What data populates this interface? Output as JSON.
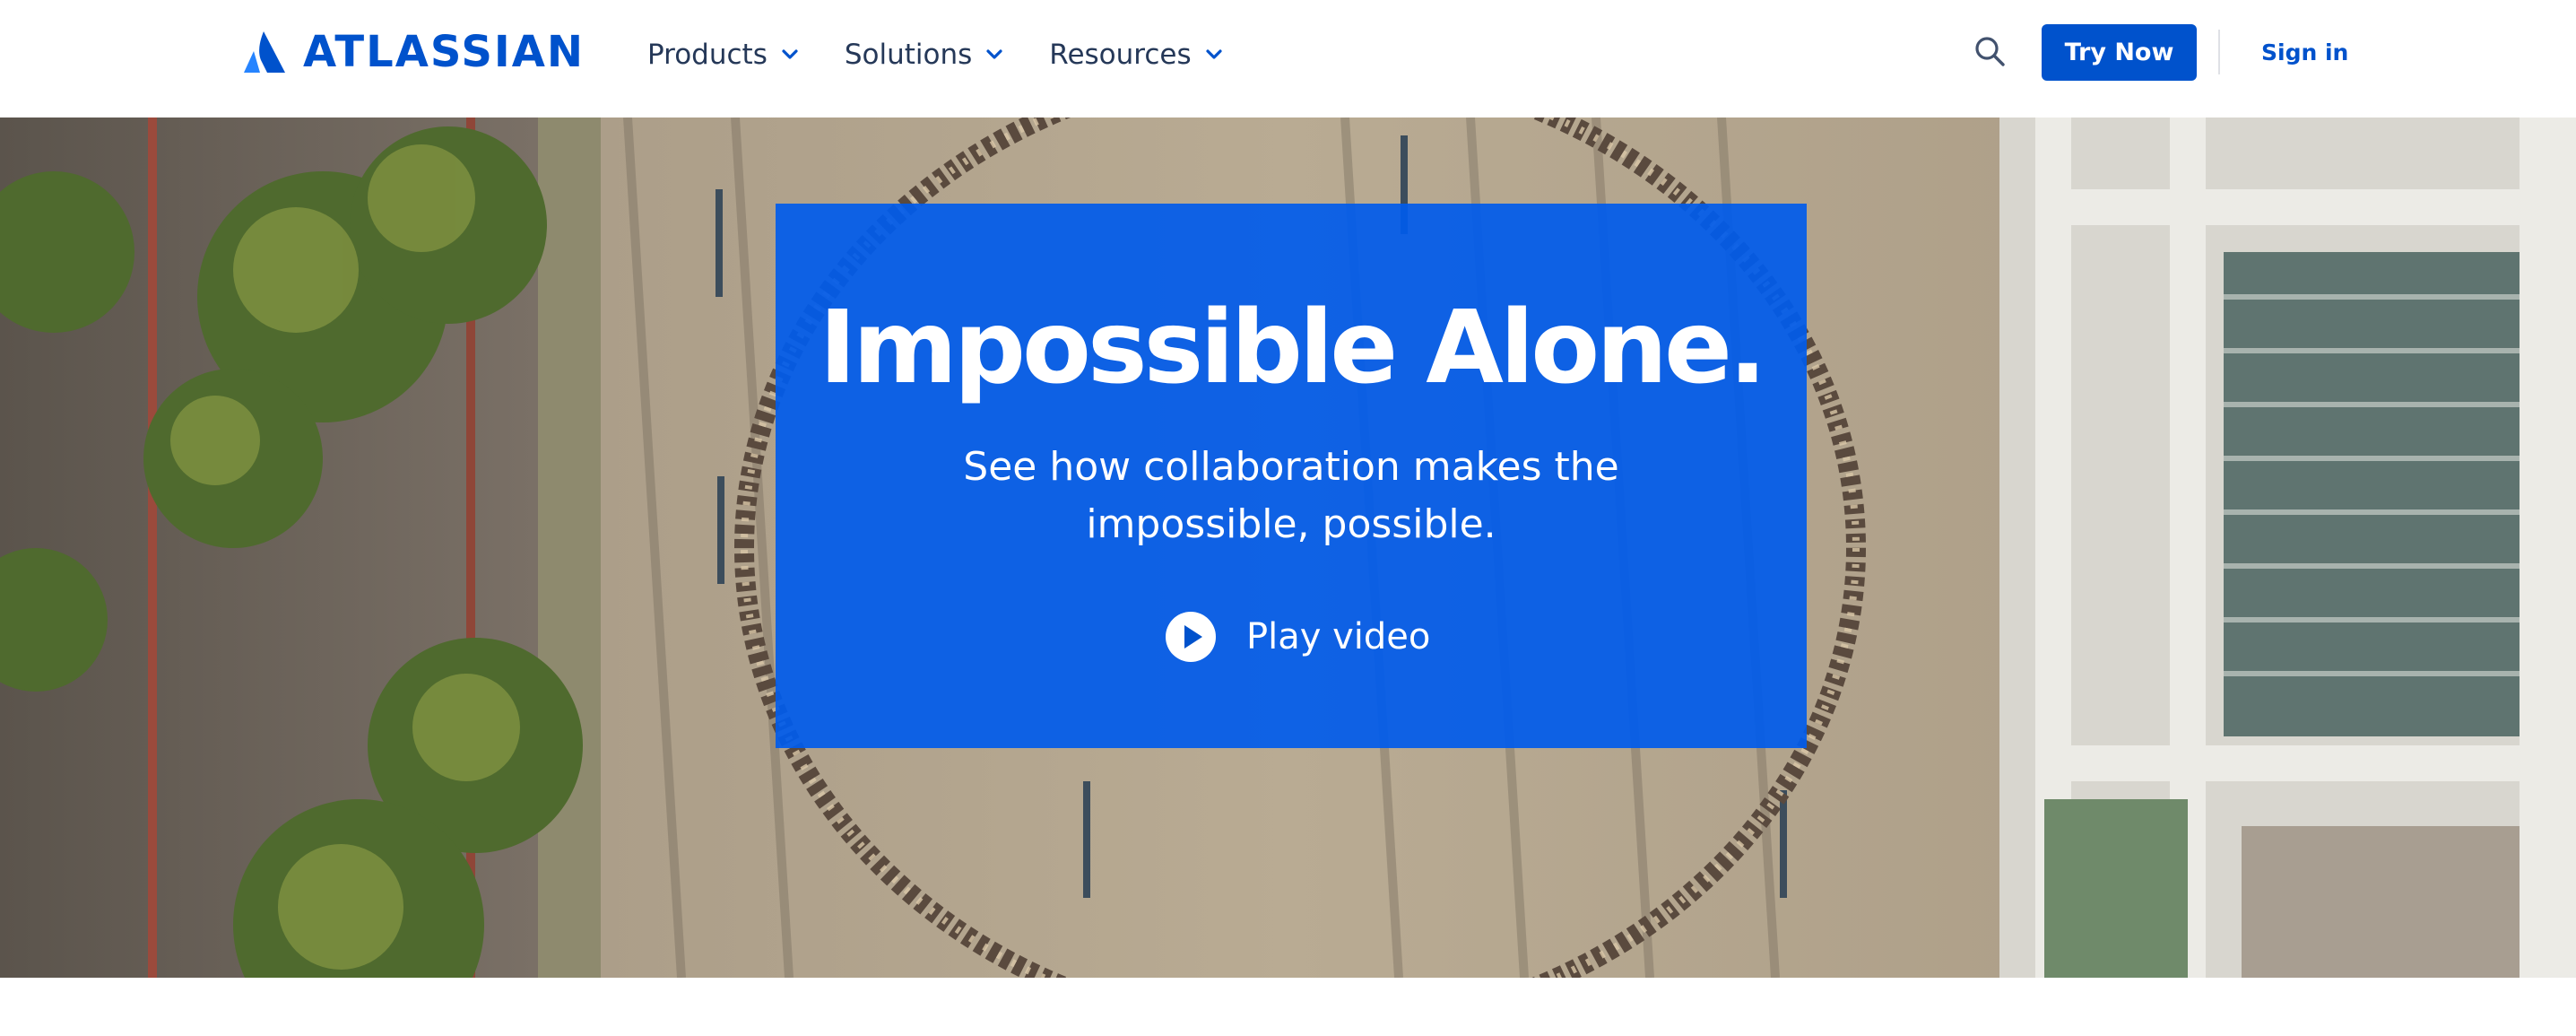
{
  "brand": {
    "name": "ATLASSIAN",
    "color": "#0052cc"
  },
  "nav": {
    "items": [
      {
        "label": "Products",
        "icon": "chevron-down-icon"
      },
      {
        "label": "Solutions",
        "icon": "chevron-down-icon"
      },
      {
        "label": "Resources",
        "icon": "chevron-down-icon"
      }
    ]
  },
  "actions": {
    "search_icon": "search-icon",
    "try_now_label": "Try Now",
    "sign_in_label": "Sign in"
  },
  "hero": {
    "title": "Impossible Alone.",
    "subtitle_line1": "See how collaboration makes the",
    "subtitle_line2": "impossible, possible.",
    "play_label": "Play video",
    "play_icon": "play-circle-icon",
    "card_color": "#005beb"
  }
}
